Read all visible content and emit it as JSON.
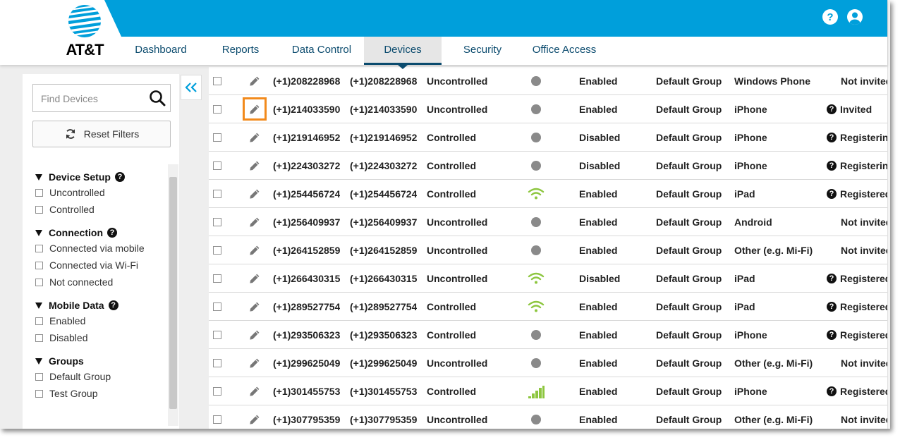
{
  "header": {
    "logo_text": "AT&T",
    "brand_color": "#009fdb",
    "help_icon": "help-circle-icon",
    "account_icon": "user-circle-icon"
  },
  "nav": {
    "tabs": [
      {
        "label": "Dashboard",
        "active": false
      },
      {
        "label": "Reports",
        "active": false
      },
      {
        "label": "Data Control",
        "active": false
      },
      {
        "label": "Devices",
        "active": true
      },
      {
        "label": "Security",
        "active": false
      },
      {
        "label": "Office Access",
        "active": false
      }
    ]
  },
  "sidebar": {
    "search_placeholder": "Find Devices",
    "reset_label": "Reset Filters",
    "filters": [
      {
        "title": "Device Setup",
        "help": true,
        "options": [
          "Uncontrolled",
          "Controlled"
        ]
      },
      {
        "title": "Connection",
        "help": true,
        "options": [
          "Connected via mobile",
          "Connected via Wi-Fi",
          "Not connected"
        ]
      },
      {
        "title": "Mobile Data",
        "help": true,
        "options": [
          "Enabled",
          "Disabled"
        ]
      },
      {
        "title": "Groups",
        "help": false,
        "options": [
          "Default Group",
          "Test Group"
        ]
      }
    ]
  },
  "table": {
    "highlight_color": "#f28a1c",
    "rows": [
      {
        "number": "(+1)208228968",
        "name": "(+1)208228968",
        "setup": "Uncontrolled",
        "connection": "none",
        "data": "Enabled",
        "group": "Default Group",
        "device": "Windows Phone",
        "invite": "Not invited",
        "invite_help": false,
        "edit_highlight": false
      },
      {
        "number": "(+1)214033590",
        "name": "(+1)214033590",
        "setup": "Uncontrolled",
        "connection": "none",
        "data": "Enabled",
        "group": "Default Group",
        "device": "iPhone",
        "invite": "Invited",
        "invite_help": true,
        "edit_highlight": true
      },
      {
        "number": "(+1)219146952",
        "name": "(+1)219146952",
        "setup": "Controlled",
        "connection": "none",
        "data": "Disabled",
        "group": "Default Group",
        "device": "iPhone",
        "invite": "Registering",
        "invite_help": true,
        "edit_highlight": false
      },
      {
        "number": "(+1)224303272",
        "name": "(+1)224303272",
        "setup": "Controlled",
        "connection": "none",
        "data": "Disabled",
        "group": "Default Group",
        "device": "iPhone",
        "invite": "Registering",
        "invite_help": true,
        "edit_highlight": false
      },
      {
        "number": "(+1)254456724",
        "name": "(+1)254456724",
        "setup": "Controlled",
        "connection": "wifi",
        "data": "Enabled",
        "group": "Default Group",
        "device": "iPad",
        "invite": "Registered",
        "invite_help": true,
        "edit_highlight": false
      },
      {
        "number": "(+1)256409937",
        "name": "(+1)256409937",
        "setup": "Uncontrolled",
        "connection": "none",
        "data": "Enabled",
        "group": "Default Group",
        "device": "Android",
        "invite": "Not invited",
        "invite_help": false,
        "edit_highlight": false
      },
      {
        "number": "(+1)264152859",
        "name": "(+1)264152859",
        "setup": "Uncontrolled",
        "connection": "none",
        "data": "Enabled",
        "group": "Default Group",
        "device": "Other (e.g. Mi-Fi)",
        "invite": "Not invited",
        "invite_help": false,
        "edit_highlight": false
      },
      {
        "number": "(+1)266430315",
        "name": "(+1)266430315",
        "setup": "Uncontrolled",
        "connection": "wifi",
        "data": "Disabled",
        "group": "Default Group",
        "device": "iPad",
        "invite": "Registered",
        "invite_help": true,
        "edit_highlight": false
      },
      {
        "number": "(+1)289527754",
        "name": "(+1)289527754",
        "setup": "Controlled",
        "connection": "wifi",
        "data": "Enabled",
        "group": "Default Group",
        "device": "iPad",
        "invite": "Registered",
        "invite_help": true,
        "edit_highlight": false
      },
      {
        "number": "(+1)293506323",
        "name": "(+1)293506323",
        "setup": "Controlled",
        "connection": "none",
        "data": "Enabled",
        "group": "Default Group",
        "device": "iPhone",
        "invite": "Registered",
        "invite_help": true,
        "edit_highlight": false
      },
      {
        "number": "(+1)299625049",
        "name": "(+1)299625049",
        "setup": "Uncontrolled",
        "connection": "none",
        "data": "Enabled",
        "group": "Default Group",
        "device": "Other (e.g. Mi-Fi)",
        "invite": "Not invited",
        "invite_help": false,
        "edit_highlight": false
      },
      {
        "number": "(+1)301455753",
        "name": "(+1)301455753",
        "setup": "Controlled",
        "connection": "mobile",
        "data": "Enabled",
        "group": "Default Group",
        "device": "iPhone",
        "invite": "Registered",
        "invite_help": true,
        "edit_highlight": false
      },
      {
        "number": "(+1)307795359",
        "name": "(+1)307795359",
        "setup": "Uncontrolled",
        "connection": "none",
        "data": "Enabled",
        "group": "Default Group",
        "device": "Other (e.g. Mi-Fi)",
        "invite": "Not invited",
        "invite_help": false,
        "edit_highlight": false
      }
    ]
  }
}
